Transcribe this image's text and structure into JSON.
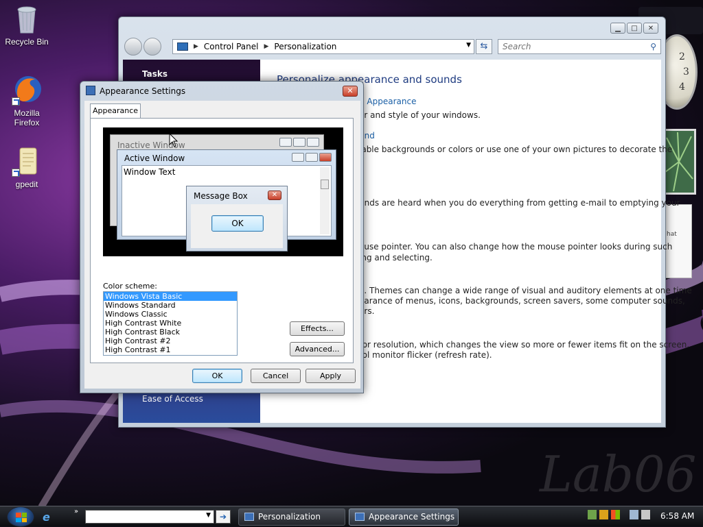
{
  "desktop": {
    "icons": [
      {
        "label": "Recycle Bin"
      },
      {
        "label": "Mozilla Firefox"
      },
      {
        "label": "gpedit"
      }
    ],
    "watermark": "Lab06"
  },
  "control_panel": {
    "breadcrumb": [
      "Control Panel",
      "Personalization"
    ],
    "search_placeholder": "Search",
    "sidebar": {
      "tasks": "Tasks",
      "ease_of_access": "Ease of Access"
    },
    "heading": "Personalize appearance and sounds",
    "visible_lines": [
      "d Appearance",
      "er and style of your windows.",
      "und",
      "lable backgrounds or colors or use one of your own pictures to decorate the",
      "unds are heard when you do everything from getting e-mail to emptying your",
      "ouse pointer. You can also change how the mouse pointer looks during such",
      "ing and selecting.",
      "e. Themes can change a wide range of visual and auditory elements at one time",
      "earance of menus, icons, backgrounds, screen savers, some computer sounds,",
      "ers.",
      "tor resolution, which changes the view so more or fewer items fit on the screen.",
      "rol monitor flicker (refresh rate)."
    ]
  },
  "dialog": {
    "title": "Appearance Settings",
    "tab": "Appearance",
    "preview": {
      "inactive_window": "Inactive Window",
      "active_window": "Active Window",
      "window_text": "Window Text",
      "message_box": "Message Box",
      "ok": "OK"
    },
    "color_scheme_label": "Color scheme:",
    "color_schemes": [
      "Windows Vista Basic",
      "Windows Standard",
      "Windows Classic",
      "High Contrast White",
      "High Contrast Black",
      "High Contrast #2",
      "High Contrast #1"
    ],
    "selected_scheme": "Windows Vista Basic",
    "buttons": {
      "effects": "Effects...",
      "advanced": "Advanced...",
      "ok": "OK",
      "cancel": "Cancel",
      "apply": "Apply"
    }
  },
  "taskbar": {
    "tasks": [
      {
        "label": "Personalization",
        "active": false
      },
      {
        "label": "Appearance Settings",
        "active": true
      }
    ],
    "time": "6:58 AM"
  },
  "gadgets": {
    "clock_numerals": [
      "2",
      "3",
      "4"
    ],
    "notes_text": "hat"
  },
  "colors": {
    "selection": "#3399ff",
    "link": "#1a5fa6",
    "heading": "#1e3b80"
  }
}
